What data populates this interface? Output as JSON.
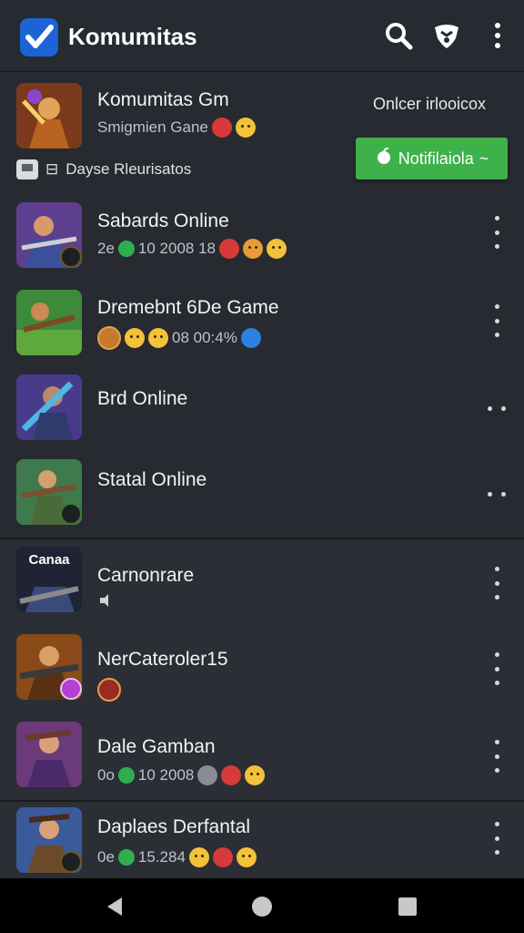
{
  "header": {
    "title": "Komumitas",
    "icons": [
      "check-logo-icon",
      "search-icon",
      "badge-icon",
      "more-vert-icon"
    ]
  },
  "featured": {
    "name": "Komumitas Gm",
    "subtitle": "Smigmien Gane",
    "right_note": "Onlcer irlooicox",
    "meta_label": "Dayse Rleurisatos",
    "button_label": "Notifilaiola",
    "button_chevron": "~"
  },
  "games": [
    {
      "name": "Sabards Online",
      "stats_a": "2e",
      "stats_b": "10 2008 18"
    },
    {
      "name": "Dremebnt 6De Game",
      "stats_a": "08 00:4%"
    },
    {
      "name": "Brd Online"
    },
    {
      "name": "Statal Online"
    },
    {
      "name": "Carnonrare",
      "thumb_text": "Canaa"
    },
    {
      "name": "NerCateroler15"
    },
    {
      "name": "Dale Gamban",
      "stats_a": "0o",
      "stats_b": "10 2008"
    },
    {
      "name": "Daplaes Derfantal",
      "stats_a": "0e",
      "stats_b": "15.284"
    }
  ],
  "colors": {
    "appbar": "#262a31",
    "background": "#22252b",
    "accent_green": "#3fb14a",
    "logo_blue": "#1c63d6"
  },
  "navigation": [
    "back-icon",
    "home-icon",
    "recents-icon"
  ]
}
